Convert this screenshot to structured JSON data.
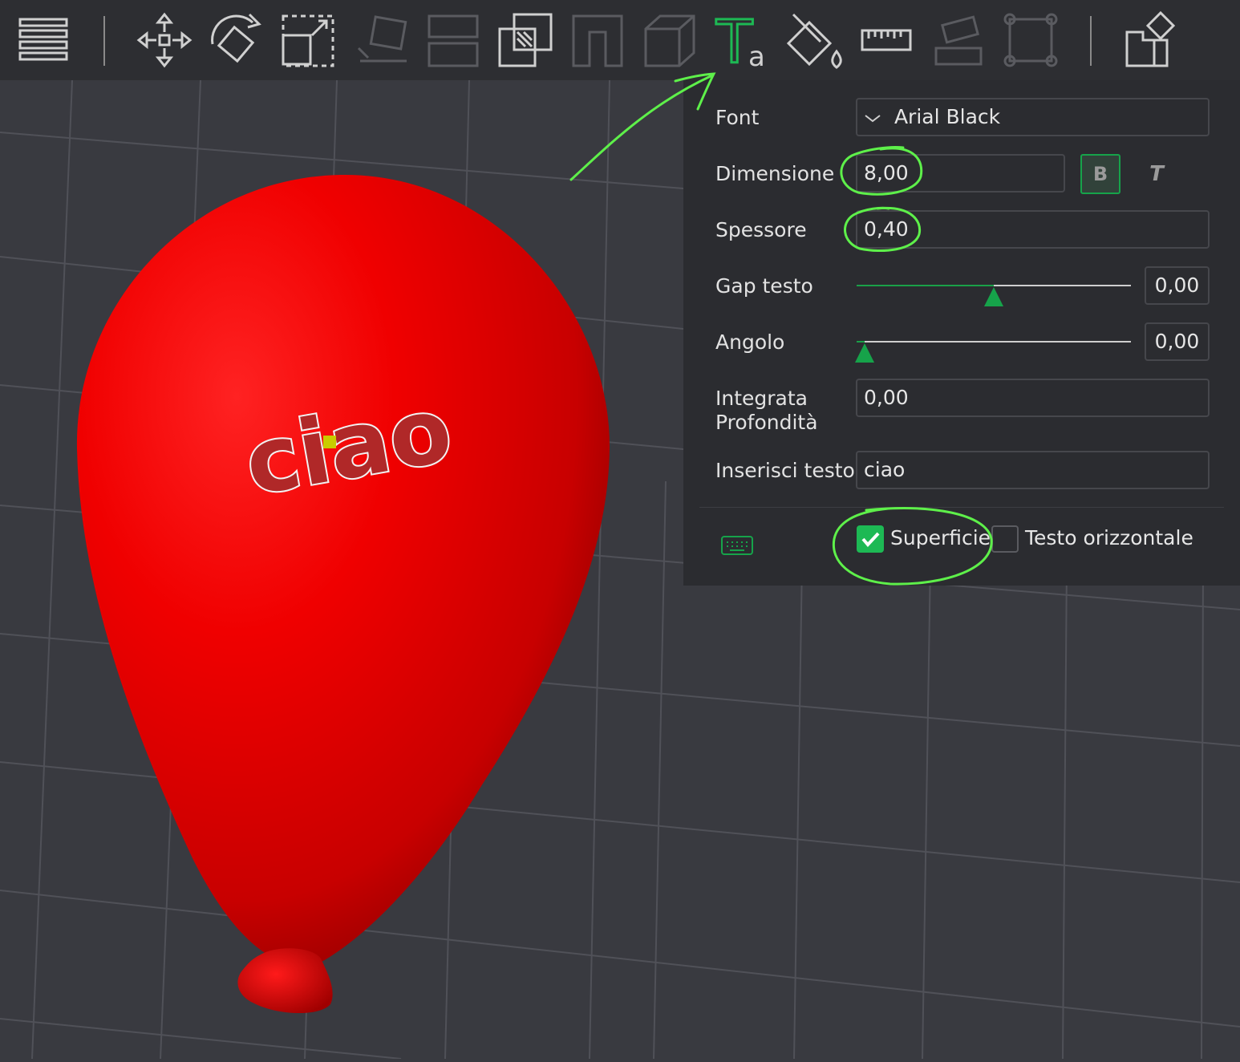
{
  "toolbar": {
    "tools": [
      {
        "name": "menu-icon",
        "state": "normal"
      },
      {
        "name": "move-icon",
        "state": "normal"
      },
      {
        "name": "rotate-icon",
        "state": "normal"
      },
      {
        "name": "scale-icon",
        "state": "normal"
      },
      {
        "name": "lay-flat-icon",
        "state": "disabled"
      },
      {
        "name": "split-icon",
        "state": "disabled"
      },
      {
        "name": "boolean-icon",
        "state": "normal"
      },
      {
        "name": "hollow-icon",
        "state": "disabled"
      },
      {
        "name": "box-icon",
        "state": "disabled"
      },
      {
        "name": "text-tool-icon",
        "state": "active"
      },
      {
        "name": "paint-bucket-icon",
        "state": "normal"
      },
      {
        "name": "ruler-icon",
        "state": "normal"
      },
      {
        "name": "assembly-icon",
        "state": "disabled"
      },
      {
        "name": "frame-icon",
        "state": "disabled"
      },
      {
        "name": "puzzle-icon",
        "state": "normal"
      }
    ],
    "active_text_glyph": "T",
    "active_text_sub": "a"
  },
  "text_panel": {
    "font_label": "Font",
    "font_value": "Arial Black",
    "size_label": "Dimensione",
    "size_value": "8,00",
    "bold_label": "B",
    "italic_label": "T",
    "thickness_label": "Spessore",
    "thickness_value": "0,40",
    "gap_label": "Gap testo",
    "gap_value": "0,00",
    "gap_slider_fraction": 0.5,
    "angle_label": "Angolo",
    "angle_value": "0,00",
    "angle_slider_fraction": 0.03,
    "depth_label_line1": "Integrata",
    "depth_label_line2": "Profondità",
    "depth_value": "0,00",
    "text_input_label": "Inserisci testo",
    "text_input_value": "ciao",
    "surface_label": "Superficie",
    "surface_checked": true,
    "horizontal_label": "Testo orizzontale",
    "horizontal_checked": false
  },
  "scene": {
    "embossed_text": "ciao",
    "balloon_color": "#e40000"
  },
  "colors": {
    "accent": "#16a34a",
    "annotation": "#5ef04a",
    "toolbar_bg": "#2d2e32",
    "panel_bg": "#2b2c30",
    "viewport_bg": "#393a40"
  }
}
